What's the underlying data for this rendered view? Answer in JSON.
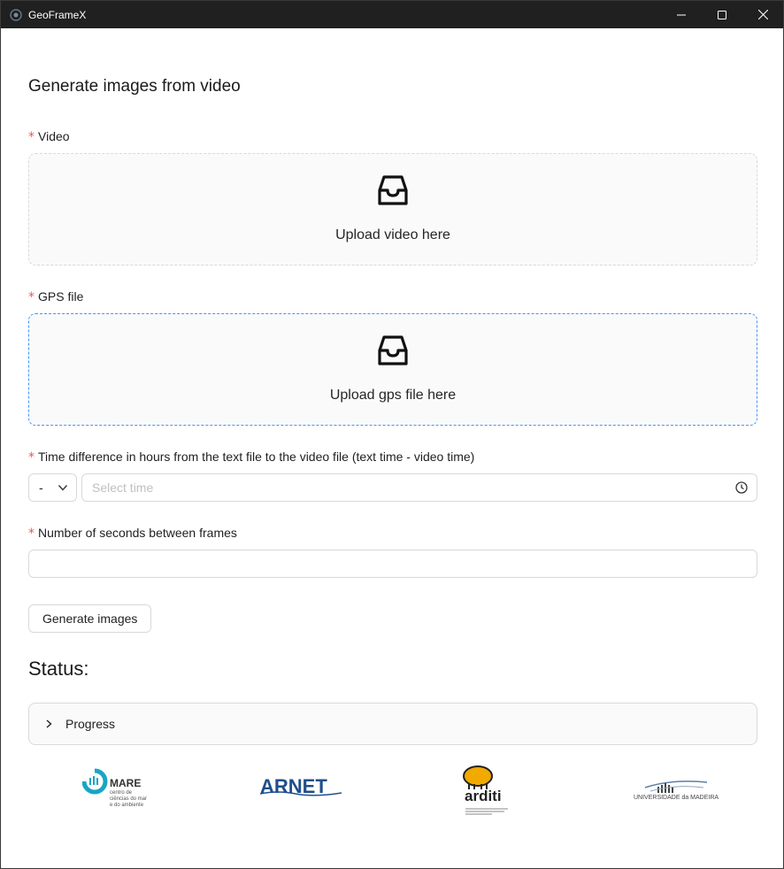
{
  "window": {
    "title": "GeoFrameX"
  },
  "page": {
    "title": "Generate images from video"
  },
  "form": {
    "required_mark": "*",
    "video": {
      "label": "Video",
      "upload_text": "Upload video here",
      "icon": "inbox-icon"
    },
    "gps": {
      "label": "GPS file",
      "upload_text": "Upload gps file here",
      "icon": "inbox-icon"
    },
    "time_difference": {
      "label": "Time difference in hours from the text file to the video file (text time - video time)",
      "sign_value": "-",
      "time_placeholder": "Select time",
      "icon": "clock-icon"
    },
    "seconds_between_frames": {
      "label": "Number of seconds between frames",
      "value": ""
    },
    "generate_button": "Generate images"
  },
  "status": {
    "title": "Status:",
    "progress_label": "Progress"
  },
  "logos": {
    "mare": {
      "name": "MARE",
      "line1": "centro de",
      "line2": "ciências do mar",
      "line3": "e do ambiente"
    },
    "arnet": {
      "name": "ARNET"
    },
    "arditi": {
      "name": "arditi"
    },
    "uma": {
      "name": "UNIVERSIDADE da MADEIRA"
    }
  },
  "colors": {
    "required": "#ff4d4f",
    "active_border": "#4096ff",
    "mare_teal": "#19a5c4",
    "arnet_blue": "#1f4e8c",
    "arditi_orange": "#f2a900"
  }
}
